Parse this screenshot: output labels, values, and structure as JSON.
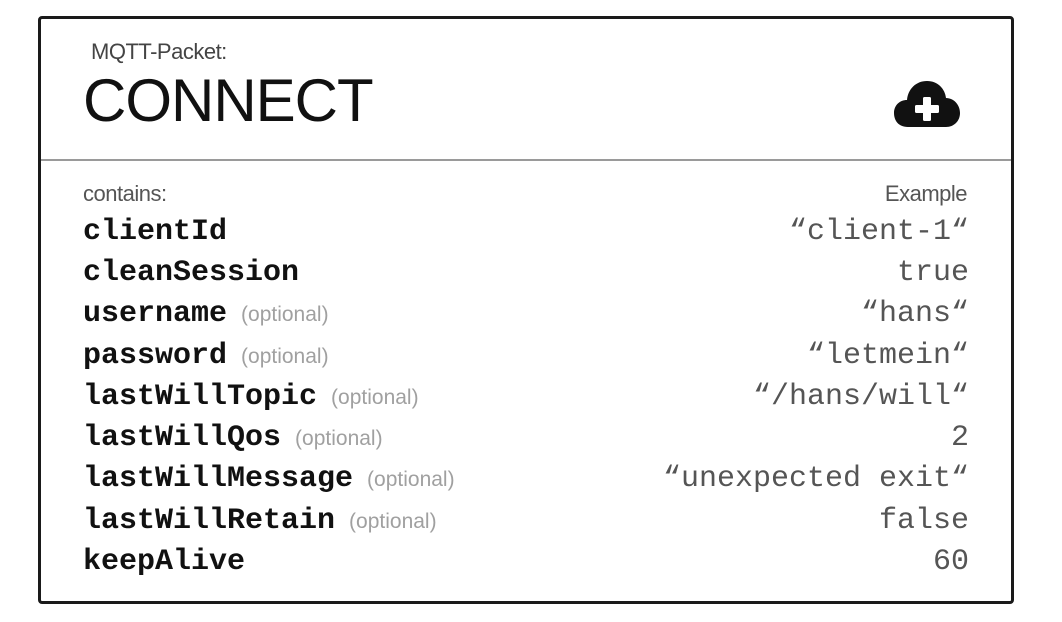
{
  "header": {
    "packet_label": "MQTT-Packet:",
    "packet_title": "CONNECT",
    "icon": "cloud-plus-icon"
  },
  "body": {
    "contains_label": "contains:",
    "example_label": "Example",
    "optional_text": "(optional)",
    "fields": [
      {
        "name": "clientId",
        "optional": "",
        "example": "“client-1“"
      },
      {
        "name": "cleanSession",
        "optional": "",
        "example": "true"
      },
      {
        "name": "username",
        "optional": "(optional)",
        "example": "“hans“"
      },
      {
        "name": "password",
        "optional": "(optional)",
        "example": "“letmein“"
      },
      {
        "name": "lastWillTopic",
        "optional": "(optional)",
        "example": "“/hans/will“"
      },
      {
        "name": "lastWillQos",
        "optional": "(optional)",
        "example": "2"
      },
      {
        "name": "lastWillMessage",
        "optional": "(optional)",
        "example": "“unexpected exit“"
      },
      {
        "name": "lastWillRetain",
        "optional": "(optional)",
        "example": "false"
      },
      {
        "name": "keepAlive",
        "optional": "",
        "example": "60"
      }
    ]
  },
  "colors": {
    "border": "#1a1a1a",
    "divider": "#9a9a9a",
    "optional": "#a0a0a0",
    "example": "#555555"
  }
}
